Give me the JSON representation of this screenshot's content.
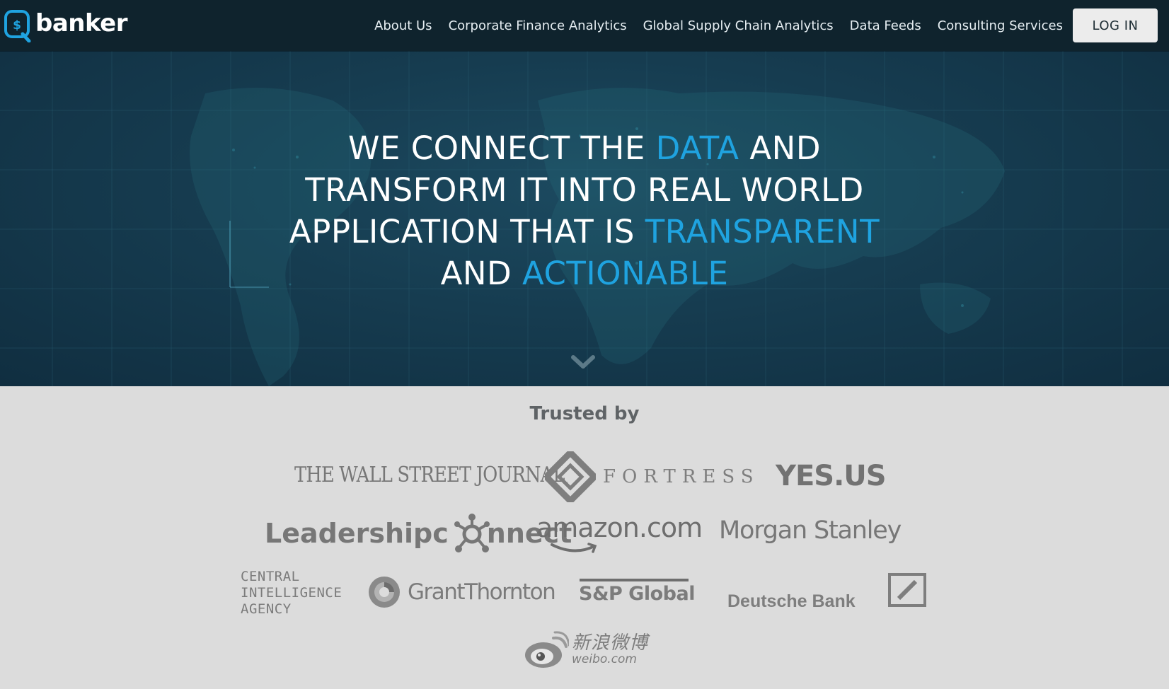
{
  "brand": {
    "logo_text": "banker",
    "logo_symbol": "$",
    "logo_icon": "search-dollar-icon"
  },
  "nav": {
    "links": [
      "About Us",
      "Corporate Finance Analytics",
      "Global Supply Chain Analytics",
      "Data Feeds",
      "Consulting Services"
    ],
    "login_label": "LOG IN"
  },
  "hero": {
    "line1_a": "WE CONNECT THE ",
    "line1_hl": "DATA",
    "line1_b": " AND",
    "line2": "TRANSFORM IT INTO REAL WORLD",
    "line3_a": "APPLICATION THAT IS ",
    "line3_hl": "TRANSPARENT",
    "line4_a": "AND ",
    "line4_hl": "ACTIONABLE",
    "scroll_icon": "chevron-down-icon"
  },
  "trusted": {
    "title": "Trusted by",
    "logos": {
      "wsj": "THE WALL STREET JOURNAL.",
      "fortress": "FORTRESS",
      "yesus": "YES.US",
      "leadership_a": "Leadership ",
      "leadership_b": "c",
      "leadership_c": "nnect",
      "amazon": "amazon.com",
      "morgan": "Morgan Stanley",
      "cia_1": "CENTRAL",
      "cia_2": "INTELLIGENCE",
      "cia_3": "AGENCY",
      "grant": "GrantThornton",
      "sp": "S&P Global",
      "deutsche": "Deutsche Bank",
      "weibo_cn": "新浪微博",
      "weibo_en": "weibo.com"
    }
  },
  "colors": {
    "nav_bg": "#0f232d",
    "hero_bg": "#163c50",
    "accent": "#1fa3e0",
    "trusted_bg": "#dcdcdc",
    "logo_gray": "#7a7a7a"
  }
}
